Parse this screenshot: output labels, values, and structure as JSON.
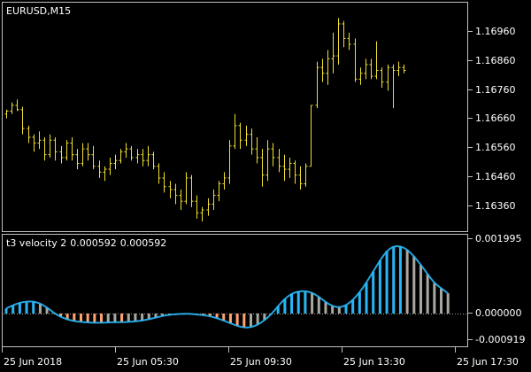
{
  "price_chart": {
    "title": "EURUSD,M15",
    "price_labels": [
      "1.16960",
      "1.16860",
      "1.16760",
      "1.16660",
      "1.16560",
      "1.16460",
      "1.16360"
    ],
    "bar_color": "#f0e030"
  },
  "indicator": {
    "name": "t3 velocity 2",
    "value1": "0.000592",
    "value2": "0.000592",
    "scale_labels": [
      "0.001995",
      "0.000000",
      "-0.000919"
    ],
    "colors": {
      "positive": "#29b6f6",
      "negative": "#ffa270",
      "neutral": "#a8a8a0",
      "curve": "#29b6f6"
    }
  },
  "time_axis": {
    "labels": [
      "25 Jun 2018",
      "25 Jun 05:30",
      "25 Jun 09:30",
      "25 Jun 13:30",
      "25 Jun 17:30"
    ]
  },
  "chart_data": [
    {
      "type": "ohlc",
      "title": "EURUSD,M15",
      "ylim": [
        1.1628,
        1.1706
      ],
      "series": [
        {
          "values": [
            [
              1.1668,
              1.16695,
              1.16665,
              1.1669
            ],
            [
              1.1669,
              1.1672,
              1.1668,
              1.1671
            ],
            [
              1.1671,
              1.1673,
              1.1669,
              1.16695
            ],
            [
              1.16695,
              1.16705,
              1.1661,
              1.1663
            ],
            [
              1.1663,
              1.1664,
              1.1658,
              1.166
            ],
            [
              1.166,
              1.1661,
              1.1655,
              1.1658
            ],
            [
              1.1658,
              1.1662,
              1.1656,
              1.1659
            ],
            [
              1.1659,
              1.166,
              1.1652,
              1.1654
            ],
            [
              1.1654,
              1.1661,
              1.1653,
              1.1659
            ],
            [
              1.1659,
              1.166,
              1.1652,
              1.1655
            ],
            [
              1.1655,
              1.1657,
              1.1651,
              1.1653
            ],
            [
              1.1653,
              1.1659,
              1.1652,
              1.1658
            ],
            [
              1.1658,
              1.166,
              1.1652,
              1.1654
            ],
            [
              1.1654,
              1.1656,
              1.1649,
              1.1651
            ],
            [
              1.1651,
              1.1658,
              1.165,
              1.1656
            ],
            [
              1.1656,
              1.1658,
              1.1652,
              1.1654
            ],
            [
              1.1654,
              1.1657,
              1.1649,
              1.165
            ],
            [
              1.165,
              1.1652,
              1.1646,
              1.1648
            ],
            [
              1.1648,
              1.165,
              1.1645,
              1.1649
            ],
            [
              1.1649,
              1.1653,
              1.1647,
              1.1651
            ],
            [
              1.1651,
              1.1654,
              1.1649,
              1.1652
            ],
            [
              1.1652,
              1.1656,
              1.1651,
              1.1655
            ],
            [
              1.1655,
              1.1658,
              1.1653,
              1.1656
            ],
            [
              1.1656,
              1.1657,
              1.1652,
              1.1653
            ],
            [
              1.1653,
              1.1656,
              1.1651,
              1.1654
            ],
            [
              1.1654,
              1.1656,
              1.165,
              1.1652
            ],
            [
              1.1652,
              1.1657,
              1.165,
              1.1654
            ],
            [
              1.1654,
              1.1655,
              1.1649,
              1.165
            ],
            [
              1.165,
              1.1651,
              1.1644,
              1.1646
            ],
            [
              1.1646,
              1.1648,
              1.1641,
              1.1643
            ],
            [
              1.1643,
              1.1645,
              1.1639,
              1.1642
            ],
            [
              1.1642,
              1.1644,
              1.1637,
              1.164
            ],
            [
              1.164,
              1.1642,
              1.1635,
              1.1638
            ],
            [
              1.1638,
              1.1648,
              1.1637,
              1.1646
            ],
            [
              1.1646,
              1.1647,
              1.1636,
              1.1638
            ],
            [
              1.1638,
              1.164,
              1.1632,
              1.1634
            ],
            [
              1.1634,
              1.1636,
              1.1631,
              1.1635
            ],
            [
              1.1635,
              1.1639,
              1.1633,
              1.1637
            ],
            [
              1.1637,
              1.1642,
              1.1635,
              1.164
            ],
            [
              1.164,
              1.1645,
              1.1638,
              1.1644
            ],
            [
              1.1644,
              1.1648,
              1.1642,
              1.1646
            ],
            [
              1.1646,
              1.1659,
              1.1644,
              1.1657
            ],
            [
              1.1657,
              1.1668,
              1.1656,
              1.1664
            ],
            [
              1.1664,
              1.1665,
              1.1656,
              1.1659
            ],
            [
              1.1659,
              1.1664,
              1.1657,
              1.1661
            ],
            [
              1.1661,
              1.1663,
              1.1654,
              1.1656
            ],
            [
              1.1656,
              1.166,
              1.1651,
              1.1653
            ],
            [
              1.1653,
              1.1656,
              1.1643,
              1.1647
            ],
            [
              1.1647,
              1.1659,
              1.1645,
              1.1656
            ],
            [
              1.1656,
              1.1658,
              1.165,
              1.1653
            ],
            [
              1.1653,
              1.1656,
              1.1648,
              1.165
            ],
            [
              1.165,
              1.1654,
              1.1645,
              1.1649
            ],
            [
              1.1649,
              1.1653,
              1.1646,
              1.1651
            ],
            [
              1.1651,
              1.1652,
              1.1644,
              1.1647
            ],
            [
              1.1647,
              1.165,
              1.1642,
              1.1644
            ],
            [
              1.1644,
              1.1651,
              1.1643,
              1.165
            ],
            [
              1.165,
              1.1671,
              1.165,
              1.1671
            ],
            [
              1.1671,
              1.1686,
              1.167,
              1.1684
            ],
            [
              1.1684,
              1.1687,
              1.1679,
              1.1682
            ],
            [
              1.1682,
              1.169,
              1.1678,
              1.1687
            ],
            [
              1.1687,
              1.1696,
              1.1682,
              1.1688
            ],
            [
              1.1688,
              1.1701,
              1.1685,
              1.1699
            ],
            [
              1.1699,
              1.17,
              1.1691,
              1.1694
            ],
            [
              1.1694,
              1.1696,
              1.169,
              1.1692
            ],
            [
              1.1692,
              1.1694,
              1.1679,
              1.168
            ],
            [
              1.168,
              1.1684,
              1.1678,
              1.1682
            ],
            [
              1.1682,
              1.1687,
              1.168,
              1.1685
            ],
            [
              1.1685,
              1.1687,
              1.168,
              1.1681
            ],
            [
              1.1681,
              1.1693,
              1.168,
              1.1683
            ],
            [
              1.1683,
              1.1684,
              1.1677,
              1.1679
            ],
            [
              1.1679,
              1.1685,
              1.1676,
              1.1684
            ],
            [
              1.1684,
              1.1685,
              1.167,
              1.1683
            ],
            [
              1.1683,
              1.1686,
              1.1681,
              1.1684
            ],
            [
              1.1684,
              1.1685,
              1.1682,
              1.1683
            ]
          ]
        }
      ]
    },
    {
      "type": "histogram",
      "title": "t3 velocity 2 0.000592 0.000592",
      "ylim": [
        -0.00105,
        0.00221
      ],
      "series": [
        {
          "values": [
            0.00015,
            0.00025,
            0.00032,
            0.00036,
            0.00036,
            0.0003,
            0.00018,
            2e-05,
            -0.00012,
            -0.00022,
            -0.00028,
            -0.00031,
            -0.00033,
            -0.00034,
            -0.00034,
            -0.00033,
            -0.00032,
            -0.00032,
            -0.00031,
            -0.00029,
            -0.00026,
            -0.00021,
            -0.00015,
            -9e-05,
            -5e-05,
            -2e-05,
            -1e-05,
            -1e-05,
            -3e-05,
            -6e-05,
            -0.0001,
            -0.00017,
            -0.00026,
            -0.00036,
            -0.00046,
            -0.00052,
            -0.00051,
            -0.00042,
            -0.00025,
            -3e-05,
            0.00022,
            0.00044,
            0.00059,
            0.00066,
            0.00067,
            0.00062,
            0.0005,
            0.00034,
            0.00022,
            0.00018,
            0.00024,
            0.0004,
            0.00063,
            0.00092,
            0.00125,
            0.00158,
            0.00186,
            0.002,
            0.002,
            0.0019,
            0.0017,
            0.00145,
            0.00117,
            0.00091,
            0.00075,
            0.0006
          ]
        }
      ]
    }
  ]
}
